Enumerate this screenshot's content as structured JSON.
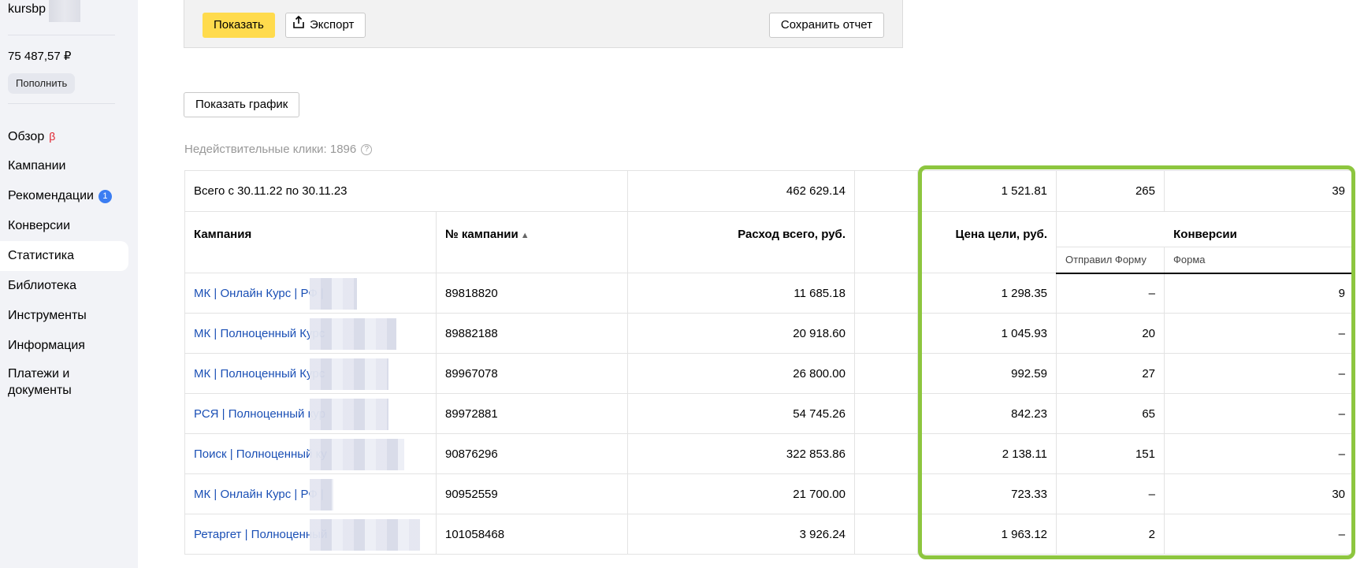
{
  "sidebar": {
    "account": "kursbp",
    "balance": "75 487,57 ₽",
    "topup_label": "Пополнить",
    "items": [
      {
        "label": "Обзор",
        "extra": "β"
      },
      {
        "label": "Кампании"
      },
      {
        "label": "Рекомендации",
        "badge": "1"
      },
      {
        "label": "Конверсии"
      },
      {
        "label": "Статистика",
        "active": true
      },
      {
        "label": "Библиотека"
      },
      {
        "label": "Инструменты"
      },
      {
        "label": "Информация"
      },
      {
        "label": "Платежи и документы"
      }
    ]
  },
  "toolbar": {
    "show_label": "Показать",
    "export_label": "Экспорт",
    "save_label": "Сохранить отчет"
  },
  "chart_button_label": "Показать график",
  "invalid_clicks": "Недействительные клики: 1896",
  "table": {
    "total": {
      "label": "Всего с 30.11.22 по 30.11.23",
      "spend": "462 629.14",
      "goal_cost": "1 521.81",
      "conv_form_sent": "265",
      "conv_form": "39"
    },
    "headers": {
      "campaign": "Кампания",
      "campaign_no": "№ кампании",
      "spend": "Расход всего, руб.",
      "goal_cost": "Цена цели, руб.",
      "conversions": "Конверсии",
      "form_sent": "Отправил Форму",
      "form": "Форма"
    },
    "rows": [
      {
        "campaign": "МК | Онлайн Курс | РФ |",
        "id": "89818820",
        "spend": "11 685.18",
        "goal_cost": "1 298.35",
        "form_sent": "–",
        "form": "9"
      },
      {
        "campaign": "МК | Полноценный Курс",
        "id": "89882188",
        "spend": "20 918.60",
        "goal_cost": "1 045.93",
        "form_sent": "20",
        "form": "–"
      },
      {
        "campaign": "МК | Полноценный Курс",
        "id": "89967078",
        "spend": "26 800.00",
        "goal_cost": "992.59",
        "form_sent": "27",
        "form": "–"
      },
      {
        "campaign": "РСЯ | Полноценный кур",
        "id": "89972881",
        "spend": "54 745.26",
        "goal_cost": "842.23",
        "form_sent": "65",
        "form": "–"
      },
      {
        "campaign": "Поиск | Полноценный ку",
        "id": "90876296",
        "spend": "322 853.86",
        "goal_cost": "2 138.11",
        "form_sent": "151",
        "form": "–"
      },
      {
        "campaign": "МК | Онлайн Курс | РФ |",
        "id": "90952559",
        "spend": "21 700.00",
        "goal_cost": "723.33",
        "form_sent": "–",
        "form": "30"
      },
      {
        "campaign": "Ретаргет | Полноценный",
        "id": "101058468",
        "spend": "3 926.24",
        "goal_cost": "1 963.12",
        "form_sent": "2",
        "form": "–"
      }
    ]
  },
  "colors": {
    "accent_yellow": "#ffdb4d",
    "link_blue": "#1a4fb5",
    "highlight_green": "#8dc63f",
    "badge_blue": "#3b7df2"
  }
}
